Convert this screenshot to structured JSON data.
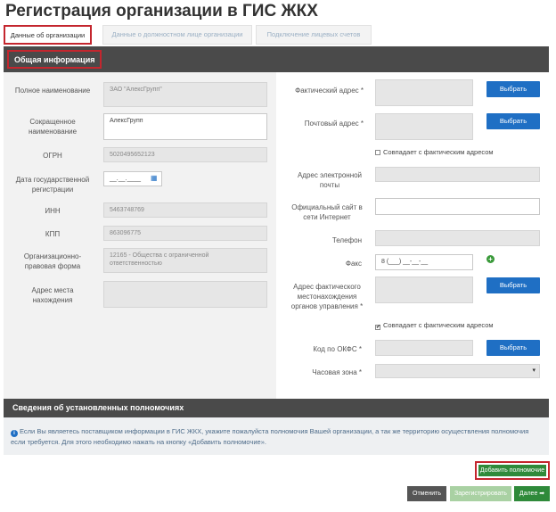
{
  "page_title": "Регистрация организации в ГИС ЖКХ",
  "tabs": [
    {
      "label": "Данные об организации"
    },
    {
      "label": "Данные о должностном лице организации"
    },
    {
      "label": "Подключение лицевых счетов"
    }
  ],
  "section_general": "Общая информация",
  "left": {
    "full_name_label": "Полное наименование",
    "full_name_value": "ЗАО \"АлексГрупп\"",
    "short_name_label": "Сокращенное наименование",
    "short_name_value": "АлексГрупп",
    "ogrn_label": "ОГРН",
    "ogrn_value": "5020495652123",
    "reg_date_label": "Дата государственной регистрации",
    "reg_date_placeholder": "__.__.____",
    "inn_label": "ИНН",
    "inn_value": "5463748769",
    "kpp_label": "КПП",
    "kpp_value": "863096775",
    "opf_label": "Организационно-правовая форма",
    "opf_value": "12165 - Общества с ограниченной ответственностью",
    "location_label": "Адрес места нахождения",
    "location_value": ""
  },
  "right": {
    "actual_address_label": "Фактический адрес *",
    "postal_address_label": "Почтовый адрес *",
    "choose_label": "Выбрать",
    "same_as_actual_label": "Совпадает с фактическим адресом",
    "email_label": "Адрес электронной почты",
    "website_label": "Официальный сайт в сети Интернет",
    "phone_label": "Телефон",
    "fax_label": "Факс",
    "fax_placeholder": "8 (___) __-__-__",
    "mgmt_address_label": "Адрес фактического местонахождения органов управления *",
    "same_as_actual_label_2": "Совпадает с фактическим адресом",
    "okfs_label": "Код по ОКФС *",
    "timezone_label": "Часовая зона *",
    "timezone_arrow": "▾"
  },
  "section_powers": "Сведения об установленных полномочиях",
  "info_text": "Если Вы являетесь поставщиком информации в ГИС ЖКХ, укажите пожалуйста полномочия Вашей организации, а так же территорию осуществления полномочия если требуется. Для этого необходимо нажать на кнопку «Добавить полномочие».",
  "info_icon": "i",
  "buttons": {
    "add_power": "Добавить полномочие",
    "cancel": "Отменить",
    "register": "Зарегистрировать",
    "next": "Далее ➡"
  },
  "colors": {
    "accent_red": "#c4262e",
    "blue": "#1f6fc4",
    "green": "#2f8a3a",
    "dark_bar": "#4a4a4a"
  }
}
